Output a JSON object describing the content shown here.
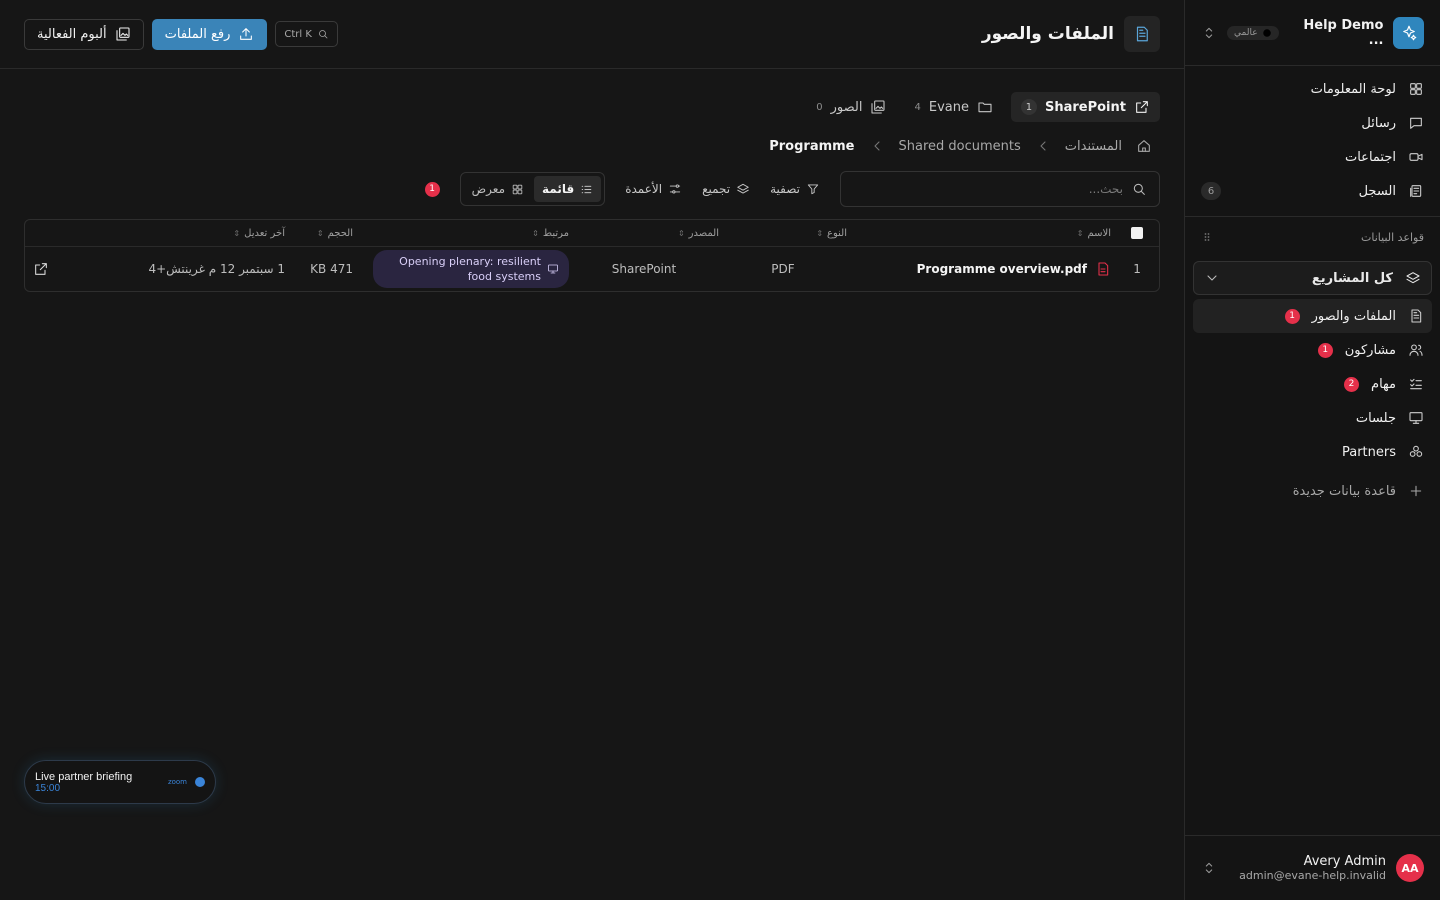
{
  "workspace": {
    "name": "Help Demo ...",
    "badge": "عالمي"
  },
  "nav": [
    {
      "label": "لوحة المعلومات",
      "icon": "dashboard-icon"
    },
    {
      "label": "رسائل",
      "icon": "message-icon"
    },
    {
      "label": "اجتماعات",
      "icon": "video-icon"
    },
    {
      "label": "السجل",
      "icon": "log-icon",
      "count": "6"
    }
  ],
  "databases": {
    "heading": "قواعد البيانات",
    "projects_label": "كل المشاريع",
    "items": [
      {
        "label": "الملفات والصور",
        "badge": "1",
        "active": true
      },
      {
        "label": "مشاركون",
        "badge": "1"
      },
      {
        "label": "مهام",
        "badge": "2"
      },
      {
        "label": "جلسات",
        "badge": ""
      },
      {
        "label": "Partners",
        "badge": ""
      }
    ],
    "new_label": "قاعدة بيانات جديدة"
  },
  "user": {
    "name": "Avery Admin",
    "email": "admin@evane-help.invalid",
    "initials": "AA"
  },
  "header": {
    "title": "الملفات والصور",
    "search_shortcut": "Ctrl K",
    "upload_label": "رفع الملفات",
    "album_label": "ألبوم الفعالية"
  },
  "sources": [
    {
      "label": "SharePoint",
      "count": "1",
      "active": true
    },
    {
      "label": "Evane",
      "count": "4"
    },
    {
      "label": "الصور",
      "count": "0"
    }
  ],
  "breadcrumb": [
    "المستندات",
    "Shared documents",
    "Programme"
  ],
  "toolbar": {
    "search_placeholder": "بحث...",
    "filter": "تصفية",
    "group": "تجميع",
    "columns": "الأعمدة",
    "list": "قائمة",
    "gallery": "معرض",
    "badge": "1"
  },
  "table": {
    "headers": {
      "name": "الاسم",
      "type": "النوع",
      "source": "المصدر",
      "related": "مرتبط",
      "size": "الحجم",
      "modified": "آخر تعديل"
    },
    "rows": [
      {
        "index": "1",
        "name": "Programme overview.pdf",
        "type": "PDF",
        "source": "SharePoint",
        "related": "Opening plenary: resilient food systems",
        "size": "471 KB",
        "modified": "1 سبتمبر 12 م غرينتش+4"
      }
    ]
  },
  "toast": {
    "title": "Live partner briefing",
    "time": "15:00",
    "tag": "zoom"
  },
  "colors": {
    "accent": "#3a84b8",
    "badge_red": "#e5304a",
    "background": "#161616"
  }
}
